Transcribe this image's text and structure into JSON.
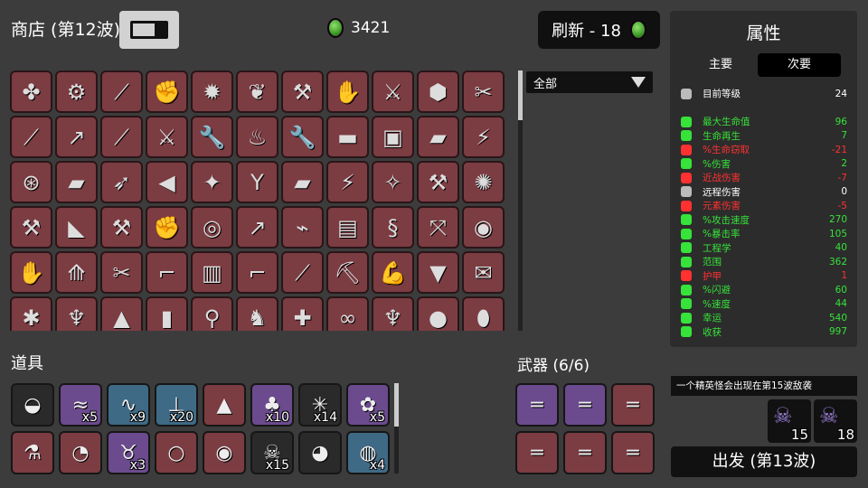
{
  "header": {
    "shop_title": "商店 (第12波)",
    "currency_amount": "3421",
    "refresh_label": "刷新 - 18"
  },
  "filter": {
    "selected": "全部"
  },
  "stats": {
    "title": "属性",
    "tab_main": "主要",
    "tab_secondary": "次要",
    "rows": [
      {
        "name": "目前等级",
        "value": "24",
        "color": "#ffffff",
        "icon": "level-icon"
      },
      {
        "name": "",
        "value": "",
        "color": "#ffffff",
        "icon": ""
      },
      {
        "name": "最大生命值",
        "value": "96",
        "color": "#37e23a",
        "icon": "heart-icon"
      },
      {
        "name": "生命再生",
        "value": "7",
        "color": "#37e23a",
        "icon": "regen-icon"
      },
      {
        "name": "%生命窃取",
        "value": "-21",
        "color": "#ff3131",
        "icon": "lifesteal-icon"
      },
      {
        "name": "%伤害",
        "value": "2",
        "color": "#37e23a",
        "icon": "damage-icon"
      },
      {
        "name": "近战伤害",
        "value": "-7",
        "color": "#ff3131",
        "icon": "melee-icon"
      },
      {
        "name": "远程伤害",
        "value": "0",
        "color": "#ffffff",
        "icon": "ranged-icon"
      },
      {
        "name": "元素伤害",
        "value": "-5",
        "color": "#ff3131",
        "icon": "elemental-icon"
      },
      {
        "name": "%攻击速度",
        "value": "270",
        "color": "#37e23a",
        "icon": "attack-speed-icon"
      },
      {
        "name": "%暴击率",
        "value": "105",
        "color": "#37e23a",
        "icon": "crit-icon"
      },
      {
        "name": "工程学",
        "value": "40",
        "color": "#37e23a",
        "icon": "engineering-icon"
      },
      {
        "name": "范围",
        "value": "362",
        "color": "#37e23a",
        "icon": "range-icon"
      },
      {
        "name": "护甲",
        "value": "1",
        "color": "#ff3131",
        "icon": "armor-icon"
      },
      {
        "name": "%闪避",
        "value": "60",
        "color": "#37e23a",
        "icon": "dodge-icon"
      },
      {
        "name": "%速度",
        "value": "44",
        "color": "#37e23a",
        "icon": "speed-icon"
      },
      {
        "name": "幸运",
        "value": "540",
        "color": "#37e23a",
        "icon": "luck-icon"
      },
      {
        "name": "收获",
        "value": "997",
        "color": "#37e23a",
        "icon": "harvest-icon"
      }
    ]
  },
  "items_title": "道具",
  "items": [
    {
      "icon": "ghost-egg-icon",
      "qty": "",
      "bg": "#2a2a2a"
    },
    {
      "icon": "wings-icon",
      "qty": "x5",
      "bg": "#6b4a8e"
    },
    {
      "icon": "worm-icon",
      "qty": "x9",
      "bg": "#3e6a86"
    },
    {
      "icon": "turret-icon",
      "qty": "x20",
      "bg": "#3e6a86"
    },
    {
      "icon": "red-shirt-icon",
      "qty": "",
      "bg": "#7b3c42"
    },
    {
      "icon": "clover-icon",
      "qty": "x10",
      "bg": "#6b4a8e"
    },
    {
      "icon": "cactus-icon",
      "qty": "x14",
      "bg": "#2a2a2a"
    },
    {
      "icon": "rabbit-icon",
      "qty": "x5",
      "bg": "#6b4a8e"
    },
    {
      "icon": "potion-icon",
      "qty": "",
      "bg": "#7b3c42"
    },
    {
      "icon": "stomach-icon",
      "qty": "",
      "bg": "#7b3c42"
    },
    {
      "icon": "demon-icon",
      "qty": "x3",
      "bg": "#6b4a8e"
    },
    {
      "icon": "ring-icon",
      "qty": "",
      "bg": "#7b3c42"
    },
    {
      "icon": "coin-icon",
      "qty": "",
      "bg": "#7b3c42"
    },
    {
      "icon": "skull-icon",
      "qty": "x15",
      "bg": "#2a2a2a"
    },
    {
      "icon": "duck-icon",
      "qty": "",
      "bg": "#2a2a2a"
    },
    {
      "icon": "pumpkin-icon",
      "qty": "x4",
      "bg": "#3e6a86"
    }
  ],
  "weapons_title": "武器 (6/6)",
  "weapons": [
    {
      "icon": "double-barrel-icon",
      "bg": "#6b4a8e"
    },
    {
      "icon": "double-barrel-icon",
      "bg": "#6b4a8e"
    },
    {
      "icon": "double-barrel-icon",
      "bg": "#7b3c42"
    },
    {
      "icon": "double-barrel-icon",
      "bg": "#7b3c42"
    },
    {
      "icon": "double-barrel-icon",
      "bg": "#7b3c42"
    },
    {
      "icon": "double-barrel-icon",
      "bg": "#7b3c42"
    }
  ],
  "elite_notice": "一个精英怪会出现在第15波敌袭",
  "enemies": [
    {
      "icon": "horned-skull-icon",
      "qty": "15"
    },
    {
      "icon": "horned-skull-icon",
      "qty": "18"
    }
  ],
  "go_button": "出发 (第13波)",
  "shop_items": [
    "mace-icon",
    "saw-icon",
    "knife-icon",
    "fist-icon",
    "fire-fist-icon",
    "leaf-icon",
    "axe-icon",
    "hand-icon",
    "sword-icon",
    "rock-icon",
    "scissors-icon",
    "screwdriver-icon",
    "spear-icon",
    "stick-icon",
    "sword-icon",
    "wrench-icon",
    "torch-icon",
    "wrench-icon",
    "shotgun-icon",
    "nail-gun-icon",
    "blaster-icon",
    "taser-icon",
    "minigun-icon",
    "blaster-icon",
    "rocket-icon",
    "megaphone-icon",
    "shuriken-icon",
    "slingshot-icon",
    "blaster-icon",
    "taser-icon",
    "wand-icon",
    "hammer-icon",
    "flail-icon",
    "axe-icon",
    "cleaver-icon",
    "hammer-icon",
    "fist-icon",
    "shield-icon",
    "spear-icon",
    "raygun-icon",
    "chest-icon",
    "scorpion-icon",
    "crossbow-icon",
    "cannon-icon",
    "glove-icon",
    "drill-icon",
    "pruner-icon",
    "revolver-icon",
    "plank-icon",
    "pistol-icon",
    "screwdriver-icon",
    "pickaxe-icon",
    "arm-icon",
    "cape-icon",
    "scroll-icon",
    "spider-icon",
    "octopus-icon",
    "gnome-icon",
    "bullet-icon",
    "shovel-icon",
    "mammoth-icon",
    "medkit-icon",
    "binoculars-icon",
    "octopus-icon",
    "panda-icon",
    "potato-icon"
  ]
}
